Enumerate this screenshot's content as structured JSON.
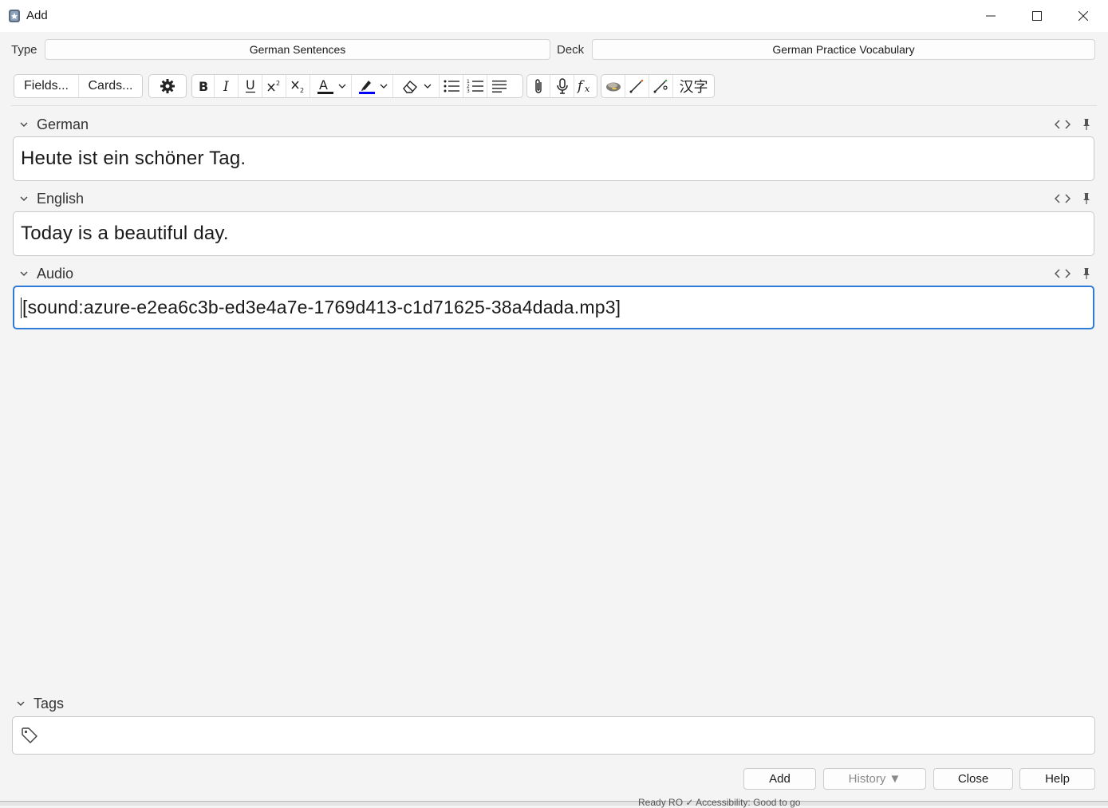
{
  "window": {
    "title": "Add",
    "controls": {
      "minimize": "minimize-icon",
      "maximize": "maximize-icon",
      "close": "close-icon"
    }
  },
  "note_type": {
    "label": "Type",
    "value": "German Sentences"
  },
  "deck": {
    "label": "Deck",
    "value": "German Practice Vocabulary"
  },
  "toolbar": {
    "fields_label": "Fields...",
    "cards_label": "Cards...",
    "chinese_label": "汉字",
    "text_color": "#1a1a1a",
    "highlight_color": "#0000ff"
  },
  "fields": [
    {
      "name": "German",
      "value": "Heute ist ein schöner Tag."
    },
    {
      "name": "English",
      "value": "Today is a beautiful day."
    },
    {
      "name": "Audio",
      "value": "[sound:azure-e2ea6c3b-ed3e4a7e-1769d413-c1d71625-38a4dada.mp3]",
      "focused": true
    }
  ],
  "tags": {
    "label": "Tags",
    "value": ""
  },
  "buttons": {
    "add": "Add",
    "history": "History ▼",
    "close": "Close",
    "help": "Help"
  },
  "background_status": "Ready   RO   ✓ Accessibility: Good to go",
  "colors": {
    "focus_border": "#2f7bd8",
    "window_bg": "#f4f4f4"
  }
}
